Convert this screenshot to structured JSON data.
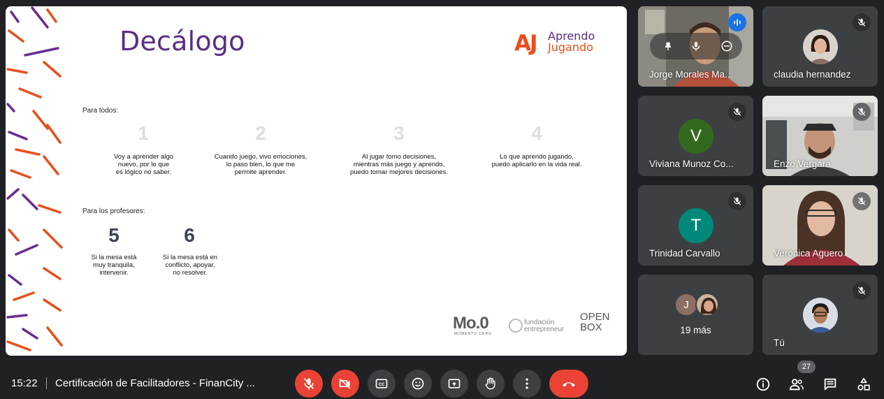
{
  "slide": {
    "title": "Decálogo",
    "brand": {
      "mark": "AJ",
      "line1": "Aprendo",
      "line2": "Jugando"
    },
    "section_all": "Para todos:",
    "rules_all": [
      {
        "num": "1",
        "text": "Voy a aprender algo\nnuevo, por lo que\nes lógico no saber."
      },
      {
        "num": "2",
        "text": "Cuando juego, vivo emociones,\nlo paso bien, lo que me\npermite aprender."
      },
      {
        "num": "3",
        "text": "Al jugar tomo decisiones,\nmientras más juego y aprendo,\npuedo tomar mejores decisiones."
      },
      {
        "num": "4",
        "text": "Lo que aprendo jugando,\npuedo aplicarlo en la vida real."
      }
    ],
    "section_teachers": "Para los profesores:",
    "rules_teachers": [
      {
        "num": "5",
        "text": "Si la mesa está\nmuy tranquila,\nintervenir."
      },
      {
        "num": "6",
        "text": "Si la mesa está en\nconflicto, apoyar,\nno resolver."
      }
    ],
    "footer_logos": {
      "moo": "Mo.0",
      "moo_sub": "MOMENTO CERO",
      "fe_line1": "fundación",
      "fe_line2": "entrepreneur",
      "ob_line1": "OPEN",
      "ob_line2": "BOX"
    }
  },
  "participants": [
    {
      "name": "Jorge Morales Ma...",
      "type": "video",
      "speaking": true
    },
    {
      "name": "claudia hernandez",
      "type": "photo",
      "muted": true
    },
    {
      "name": "Viviana Munoz Co...",
      "type": "initial",
      "initial": "V",
      "color": "#33691e",
      "muted": true
    },
    {
      "name": "Enzo Vergara",
      "type": "video",
      "muted": true
    },
    {
      "name": "Trinidad Carvallo",
      "type": "initial",
      "initial": "T",
      "color": "#00897b",
      "muted": true
    },
    {
      "name": "Veronica Aguero",
      "type": "video",
      "muted": true
    },
    {
      "name": "19 más",
      "type": "more",
      "initial": "J",
      "color": "#8d6e63"
    },
    {
      "name": "Tú",
      "type": "photo",
      "muted": true
    }
  ],
  "bottombar": {
    "time": "15:22",
    "meeting_title": "Certificación de Facilitadores - FinanCity ...",
    "people_count": "27"
  },
  "colors": {
    "accent_blue": "#1a73e8",
    "danger_red": "#ea4335",
    "slide_purple": "#5a2d82",
    "slide_orange": "#e84e1b"
  }
}
